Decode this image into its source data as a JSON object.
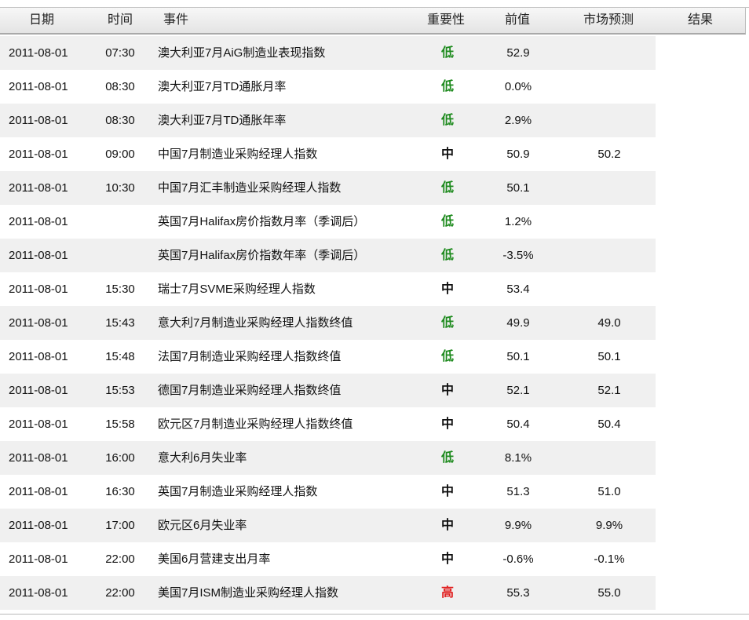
{
  "header": {
    "date": "日期",
    "time": "时间",
    "event": "事件",
    "importance": "重要性",
    "previous": "前值",
    "forecast": "市场预测",
    "result": "结果"
  },
  "colors": {
    "low": "#1f8b1f",
    "medium": "#1a1acc",
    "high": "#e01e1e"
  },
  "rows": [
    {
      "date": "2011-08-01",
      "time": "07:30",
      "event": "澳大利亚7月AiG制造业表现指数",
      "importance": "低",
      "level": "low",
      "previous": "52.9",
      "forecast": ""
    },
    {
      "date": "2011-08-01",
      "time": "08:30",
      "event": "澳大利亚7月TD通胀月率",
      "importance": "低",
      "level": "low",
      "previous": "0.0%",
      "forecast": ""
    },
    {
      "date": "2011-08-01",
      "time": "08:30",
      "event": "澳大利亚7月TD通胀年率",
      "importance": "低",
      "level": "low",
      "previous": "2.9%",
      "forecast": ""
    },
    {
      "date": "2011-08-01",
      "time": "09:00",
      "event": "中国7月制造业采购经理人指数",
      "importance": "中",
      "level": "medium",
      "previous": "50.9",
      "forecast": "50.2"
    },
    {
      "date": "2011-08-01",
      "time": "10:30",
      "event": "中国7月汇丰制造业采购经理人指数",
      "importance": "低",
      "level": "low",
      "previous": "50.1",
      "forecast": ""
    },
    {
      "date": "2011-08-01",
      "time": "",
      "event": "英国7月Halifax房价指数月率（季调后）",
      "importance": "低",
      "level": "low",
      "previous": "1.2%",
      "forecast": ""
    },
    {
      "date": "2011-08-01",
      "time": "",
      "event": "英国7月Halifax房价指数年率（季调后）",
      "importance": "低",
      "level": "low",
      "previous": "-3.5%",
      "forecast": ""
    },
    {
      "date": "2011-08-01",
      "time": "15:30",
      "event": "瑞士7月SVME采购经理人指数",
      "importance": "中",
      "level": "medium",
      "previous": "53.4",
      "forecast": ""
    },
    {
      "date": "2011-08-01",
      "time": "15:43",
      "event": "意大利7月制造业采购经理人指数终值",
      "importance": "低",
      "level": "low",
      "previous": "49.9",
      "forecast": "49.0"
    },
    {
      "date": "2011-08-01",
      "time": "15:48",
      "event": "法国7月制造业采购经理人指数终值",
      "importance": "低",
      "level": "low",
      "previous": "50.1",
      "forecast": "50.1"
    },
    {
      "date": "2011-08-01",
      "time": "15:53",
      "event": "德国7月制造业采购经理人指数终值",
      "importance": "中",
      "level": "medium",
      "previous": "52.1",
      "forecast": "52.1"
    },
    {
      "date": "2011-08-01",
      "time": "15:58",
      "event": "欧元区7月制造业采购经理人指数终值",
      "importance": "中",
      "level": "medium",
      "previous": "50.4",
      "forecast": "50.4"
    },
    {
      "date": "2011-08-01",
      "time": "16:00",
      "event": "意大利6月失业率",
      "importance": "低",
      "level": "low",
      "previous": "8.1%",
      "forecast": ""
    },
    {
      "date": "2011-08-01",
      "time": "16:30",
      "event": "英国7月制造业采购经理人指数",
      "importance": "中",
      "level": "medium",
      "previous": "51.3",
      "forecast": "51.0"
    },
    {
      "date": "2011-08-01",
      "time": "17:00",
      "event": "欧元区6月失业率",
      "importance": "中",
      "level": "medium",
      "previous": "9.9%",
      "forecast": "9.9%"
    },
    {
      "date": "2011-08-01",
      "time": "22:00",
      "event": "美国6月营建支出月率",
      "importance": "中",
      "level": "medium",
      "previous": "-0.6%",
      "forecast": "-0.1%"
    },
    {
      "date": "2011-08-01",
      "time": "22:00",
      "event": "美国7月ISM制造业采购经理人指数",
      "importance": "高",
      "level": "high",
      "previous": "55.3",
      "forecast": "55.0"
    }
  ]
}
